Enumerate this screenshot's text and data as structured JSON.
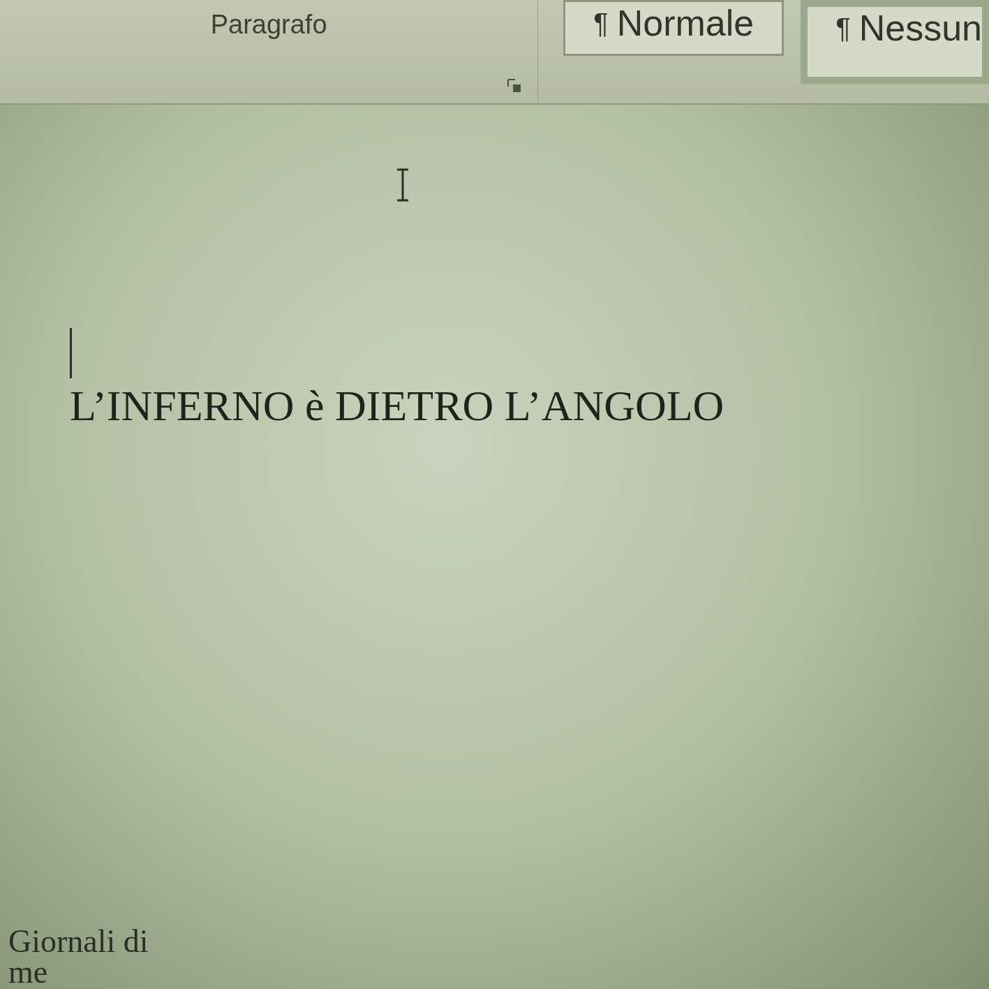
{
  "ribbon": {
    "group_label": "Paragrafo",
    "styles": [
      {
        "mark": "¶",
        "label": "Normale",
        "selected": false
      },
      {
        "mark": "¶",
        "label": "Nessun",
        "selected": true
      }
    ]
  },
  "document": {
    "title": "L’INFERNO è DIETRO L’ANGOLO",
    "lines": [
      "Giornali di",
      "me"
    ]
  }
}
